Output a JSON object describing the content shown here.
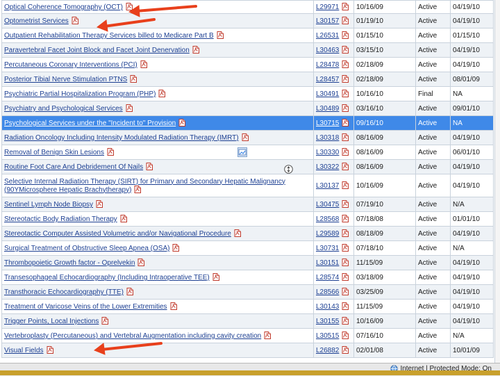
{
  "rows": [
    {
      "title": "Optical Coherence Tomography (OCT)",
      "lcd": "L29971",
      "date": "10/16/09",
      "status": "Active",
      "eff": "04/19/10"
    },
    {
      "title": "Optometrist Services",
      "lcd": "L30157",
      "date": "01/19/10",
      "status": "Active",
      "eff": "04/19/10"
    },
    {
      "title": "Outpatient Rehabilitation Therapy Services billed to Medicare Part B",
      "lcd": "L26531",
      "date": "01/15/10",
      "status": "Active",
      "eff": "01/15/10"
    },
    {
      "title": "Paravertebral Facet Joint Block and Facet Joint Denervation",
      "lcd": "L30463",
      "date": "03/15/10",
      "status": "Active",
      "eff": "04/19/10"
    },
    {
      "title": "Percutaneous Coronary Interventions (PCI)",
      "lcd": "L28478",
      "date": "02/18/09",
      "status": "Active",
      "eff": "04/19/10"
    },
    {
      "title": "Posterior Tibial Nerve Stimulation PTNS",
      "lcd": "L28457",
      "date": "02/18/09",
      "status": "Active",
      "eff": "08/01/09"
    },
    {
      "title": "Psychiatric Partial Hospitalization Program (PHP)",
      "lcd": "L30491",
      "date": "10/16/10",
      "status": "Final",
      "eff": "NA"
    },
    {
      "title": "Psychiatry and Psychological Services",
      "lcd": "L30489",
      "date": "03/16/10",
      "status": "Active",
      "eff": "09/01/10"
    },
    {
      "title": "Psychological Services under the \"Incident to\" Provision",
      "lcd": "L30715",
      "date": "09/16/10",
      "status": "Active",
      "eff": "NA"
    },
    {
      "title": "Radiation Oncology Including Intensity Modulated Radiation Therapy (IMRT)",
      "lcd": "L30318",
      "date": "08/16/09",
      "status": "Active",
      "eff": "04/19/10"
    },
    {
      "title": "Removal of Benign Skin Lesions",
      "lcd": "L30330",
      "date": "08/16/09",
      "status": "Active",
      "eff": "06/01/10"
    },
    {
      "title": "Routine Foot Care And Debridement Of Nails",
      "lcd": "L30322",
      "date": "08/16/09",
      "status": "Active",
      "eff": "04/19/10"
    },
    {
      "title": "Selective Internal Radiation Therapy (SIRT) for Primary and Secondary Hepatic Malignancy (90YMicrosphere Hepatic Brachytherapy)",
      "lcd": "L30137",
      "date": "10/16/09",
      "status": "Active",
      "eff": "04/19/10"
    },
    {
      "title": "Sentinel Lymph Node Biopsy",
      "lcd": "L30475",
      "date": "07/19/10",
      "status": "Active",
      "eff": "N/A"
    },
    {
      "title": "Stereotactic Body Radiation Therapy",
      "lcd": "L28568",
      "date": "07/18/08",
      "status": "Active",
      "eff": "01/01/10"
    },
    {
      "title": "Stereotactic Computer Assisted Volumetric and/or Navigational Procedure",
      "lcd": "L29589",
      "date": "08/18/09",
      "status": "Active",
      "eff": "04/19/10"
    },
    {
      "title": "Surgical Treatment of Obstructive Sleep Apnea (OSA)",
      "lcd": "L30731",
      "date": "07/18/10",
      "status": "Active",
      "eff": "N/A"
    },
    {
      "title": "Thrombopoietic Growth factor - Oprelvekin",
      "lcd": "L30151",
      "date": "11/15/09",
      "status": "Active",
      "eff": "04/19/10"
    },
    {
      "title": "Transesophageal Echocardiography (Including Intraoperative TEE)",
      "lcd": "L28574",
      "date": "03/18/09",
      "status": "Active",
      "eff": "04/19/10"
    },
    {
      "title": "Transthoracic Echocardiography (TTE)",
      "lcd": "L28566",
      "date": "03/25/09",
      "status": "Active",
      "eff": "04/19/10"
    },
    {
      "title": "Treatment of Varicose Veins of the Lower Extremities",
      "lcd": "L30143",
      "date": "11/15/09",
      "status": "Active",
      "eff": "04/19/10"
    },
    {
      "title": "Trigger Points, Local Injections",
      "lcd": "L30155",
      "date": "10/16/09",
      "status": "Active",
      "eff": "04/19/10"
    },
    {
      "title": "Vertebroplasty (Percutaneous) and Vertebral Augmentation including cavity creation",
      "lcd": "L30515",
      "date": "07/16/10",
      "status": "Active",
      "eff": "N/A"
    },
    {
      "title": "Visual Fields",
      "lcd": "L26882",
      "date": "02/01/08",
      "status": "Active",
      "eff": "10/01/09"
    }
  ],
  "selected_row": 8,
  "status_bar": {
    "text": "Internet | Protected Mode: On"
  },
  "colors": {
    "annotation_arrow": "#e8401c",
    "selection": "#3f89e8",
    "link": "#1c3f92",
    "footer_bar": "#c8a02c"
  },
  "icons": {
    "pdf": "pdf-icon",
    "arrow": "red-arrow-annotation",
    "globe": "globe-icon"
  }
}
